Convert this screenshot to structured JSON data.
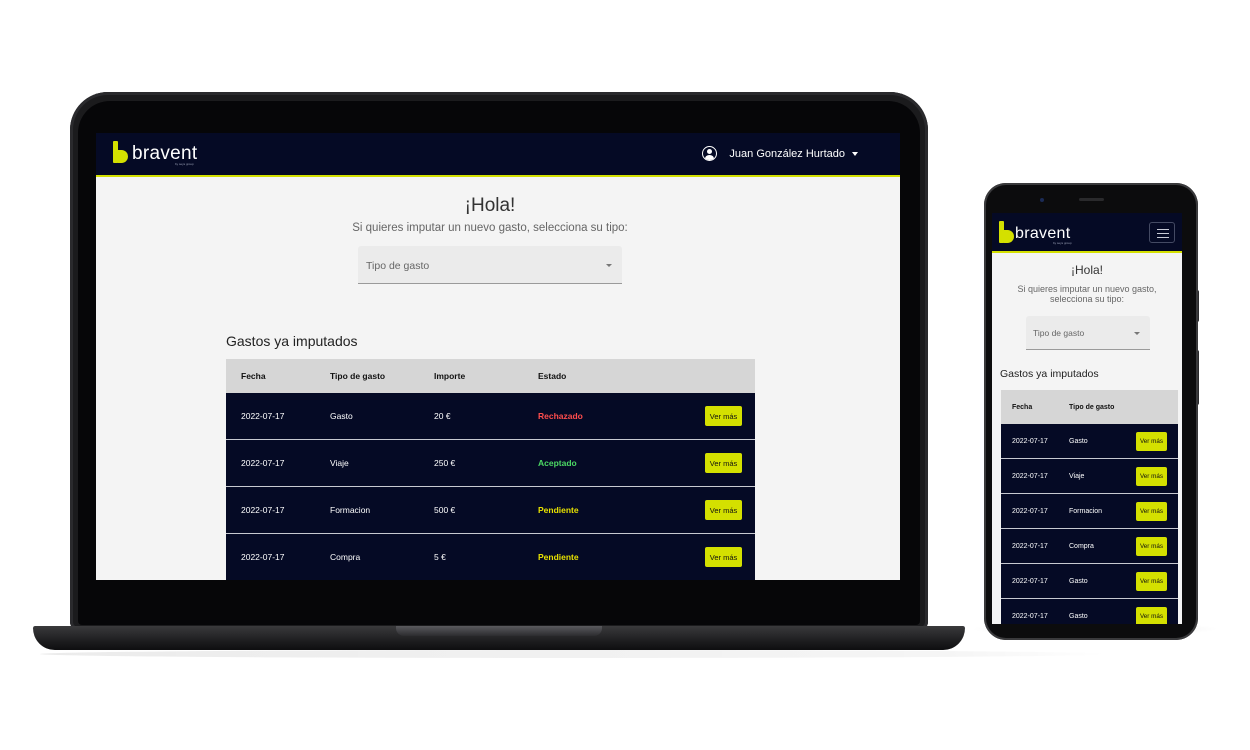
{
  "brand": {
    "name": "bravent",
    "tagline": "by seys group",
    "accent": "#d4e000",
    "navy": "#050a25"
  },
  "user": {
    "name": "Juan González Hurtado"
  },
  "greeting": {
    "title": "¡Hola!",
    "subtitle": "Si quieres imputar un nuevo gasto, selecciona su tipo:"
  },
  "select": {
    "placeholder": "Tipo de gasto"
  },
  "section_title": "Gastos ya imputados",
  "table": {
    "headers": {
      "fecha": "Fecha",
      "tipo": "Tipo de gasto",
      "importe": "Importe",
      "estado": "Estado"
    },
    "action_label": "Ver más",
    "status_colors": {
      "Rechazado": "#ff4d4d",
      "Aceptado": "#4cd964",
      "Pendiente": "#e8e200"
    },
    "rows": [
      {
        "fecha": "2022-07-17",
        "tipo": "Gasto",
        "importe": "20 €",
        "estado": "Rechazado"
      },
      {
        "fecha": "2022-07-17",
        "tipo": "Viaje",
        "importe": "250 €",
        "estado": "Aceptado"
      },
      {
        "fecha": "2022-07-17",
        "tipo": "Formacion",
        "importe": "500 €",
        "estado": "Pendiente"
      },
      {
        "fecha": "2022-07-17",
        "tipo": "Compra",
        "importe": "5 €",
        "estado": "Pendiente"
      }
    ]
  },
  "mobile_table": {
    "headers": {
      "fecha": "Fecha",
      "tipo": "Tipo de gasto"
    },
    "rows": [
      {
        "fecha": "2022-07-17",
        "tipo": "Gasto"
      },
      {
        "fecha": "2022-07-17",
        "tipo": "Viaje"
      },
      {
        "fecha": "2022-07-17",
        "tipo": "Formacion"
      },
      {
        "fecha": "2022-07-17",
        "tipo": "Compra"
      },
      {
        "fecha": "2022-07-17",
        "tipo": "Gasto"
      },
      {
        "fecha": "2022-07-17",
        "tipo": "Gasto"
      }
    ]
  }
}
